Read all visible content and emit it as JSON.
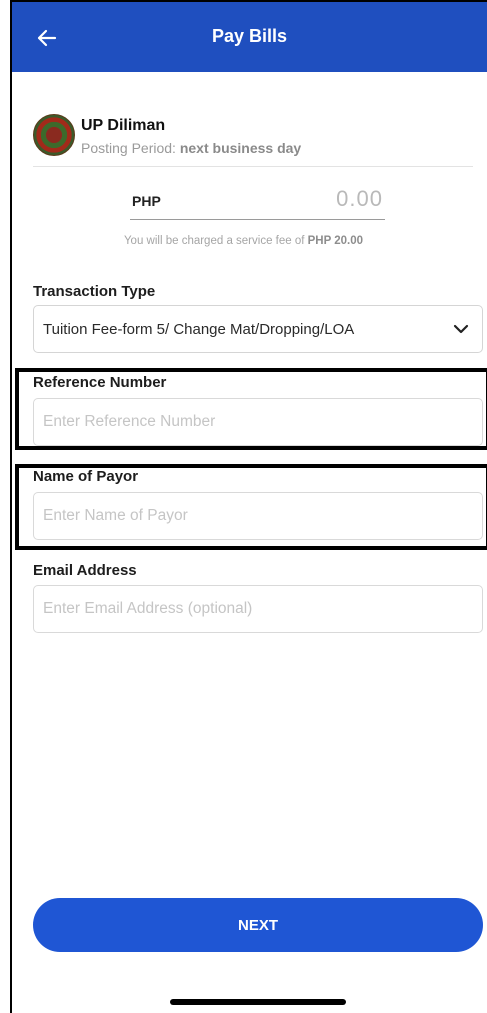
{
  "header": {
    "title": "Pay Bills",
    "back_icon": "arrow-left-icon"
  },
  "merchant": {
    "name": "UP Diliman",
    "posting_label": "Posting Period: ",
    "posting_value": "next business day"
  },
  "amount": {
    "currency": "PHP",
    "value": "0.00"
  },
  "fee": {
    "prefix": "You will be charged a service fee of ",
    "amount": "PHP 20.00"
  },
  "transaction_type": {
    "label": "Transaction Type",
    "selected": "Tuition Fee-form 5/ Change Mat/Dropping/LOA"
  },
  "reference_number": {
    "label": "Reference Number",
    "placeholder": "Enter Reference Number",
    "value": ""
  },
  "payor_name": {
    "label": "Name of Payor",
    "placeholder": "Enter Name of Payor",
    "value": ""
  },
  "email": {
    "label": "Email Address",
    "placeholder": "Enter Email Address (optional)",
    "value": ""
  },
  "next_button": {
    "label": "NEXT"
  },
  "colors": {
    "primary": "#1f4fbf",
    "button": "#1f56d4"
  }
}
